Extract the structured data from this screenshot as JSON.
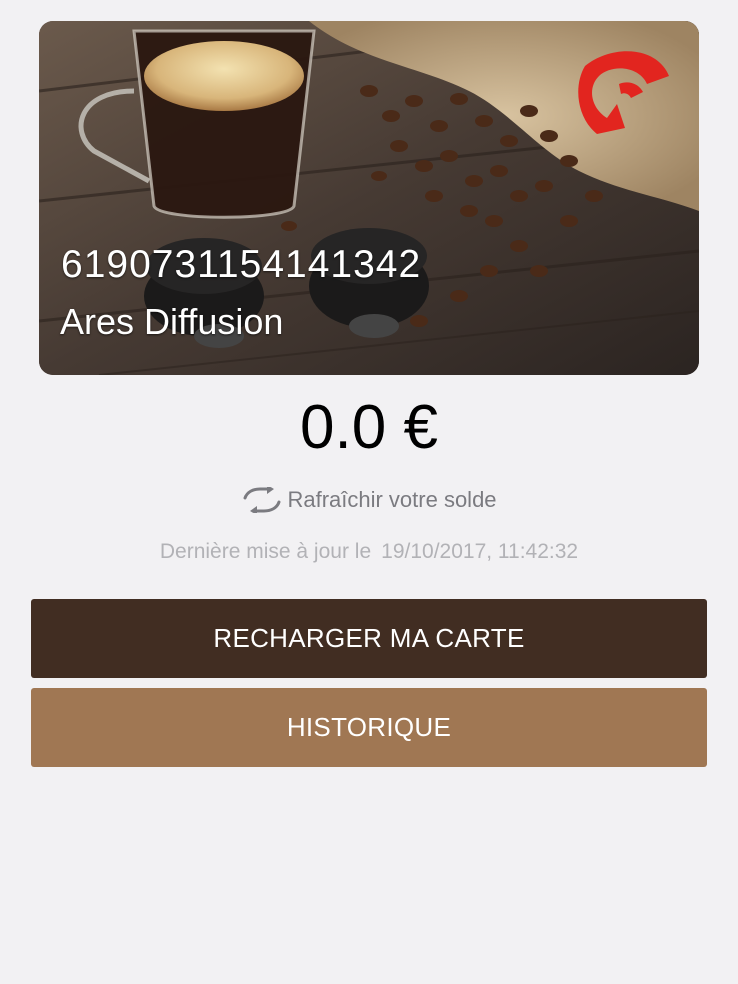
{
  "card": {
    "number": "6190731154141342",
    "holder": "Ares Diffusion",
    "logo_icon": "red-crest-logo"
  },
  "balance": {
    "amount": "0.0 €"
  },
  "refresh": {
    "icon": "refresh-icon",
    "label": "Rafraîchir votre solde"
  },
  "last_update": {
    "label": "Dernière mise à jour le",
    "datetime": "19/10/2017, 11:42:32"
  },
  "actions": {
    "recharge_label": "RECHARGER MA CARTE",
    "history_label": "HISTORIQUE"
  },
  "colors": {
    "recharge_bg": "#412d22",
    "history_bg": "#a07753",
    "page_bg": "#f2f1f3",
    "logo_red": "#e2251f"
  }
}
